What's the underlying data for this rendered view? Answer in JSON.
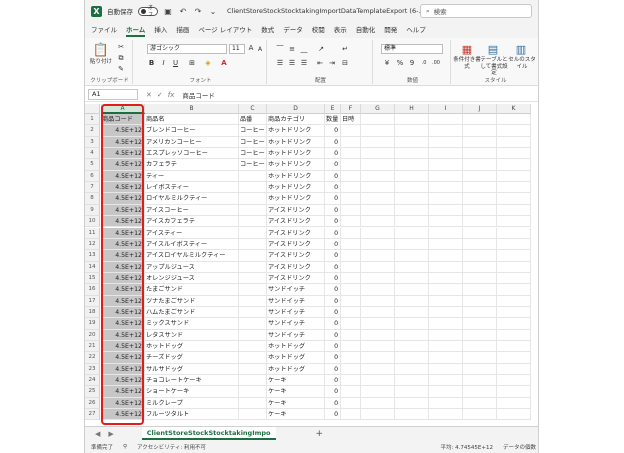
{
  "titlebar": {
    "autosave_label": "自動保存",
    "autosave_state": "オフ",
    "doc_title": "ClientStoreStockStocktakingImportDataTemplateExport (6-…",
    "search_placeholder": "検索"
  },
  "menu": {
    "tabs": [
      "ファイル",
      "ホーム",
      "挿入",
      "描画",
      "ページ レイアウト",
      "数式",
      "データ",
      "校閲",
      "表示",
      "自動化",
      "開発",
      "ヘルプ"
    ],
    "active": "ホーム"
  },
  "ribbon": {
    "paste_label": "貼り付け",
    "clipboard_label": "クリップボード",
    "font_name": "游ゴシック",
    "font_size": "11",
    "font_group_label": "フォント",
    "align_group_label": "配置",
    "number_format": "標準",
    "number_group_label": "数値",
    "cond_format_label": "条件付き書式",
    "table_format_label": "テーブルとして書式設定",
    "cell_style_label": "セルのスタイル",
    "style_group_label": "スタイル",
    "bold": "B",
    "italic": "I",
    "underline": "U",
    "percent": "%"
  },
  "formula": {
    "name_box": "A1",
    "fx": "fx",
    "value": "商品コード"
  },
  "grid": {
    "columns": [
      "A",
      "B",
      "C",
      "D",
      "E",
      "F",
      "G",
      "H",
      "I",
      "J",
      "K"
    ],
    "headers": [
      "商品コード",
      "商品名",
      "品番",
      "商品カテゴリ",
      "数量",
      "日時"
    ],
    "rows": [
      {
        "num": "2",
        "code": "4.5E+12",
        "name": "ブレンドコーヒー",
        "hinban": "コーヒー",
        "cat": "ホットドリンク",
        "qty": "0"
      },
      {
        "num": "3",
        "code": "4.5E+12",
        "name": "アメリカンコーヒー",
        "hinban": "コーヒー",
        "cat": "ホットドリンク",
        "qty": "0"
      },
      {
        "num": "4",
        "code": "4.5E+12",
        "name": "エスプレッソコーヒー",
        "hinban": "コーヒー",
        "cat": "ホットドリンク",
        "qty": "0"
      },
      {
        "num": "5",
        "code": "4.5E+12",
        "name": "カフェラテ",
        "hinban": "コーヒー",
        "cat": "ホットドリンク",
        "qty": "0"
      },
      {
        "num": "6",
        "code": "4.5E+12",
        "name": "ティー",
        "hinban": "",
        "cat": "ホットドリンク",
        "qty": "0"
      },
      {
        "num": "7",
        "code": "4.5E+12",
        "name": "レイボスティー",
        "hinban": "",
        "cat": "ホットドリンク",
        "qty": "0"
      },
      {
        "num": "8",
        "code": "4.5E+12",
        "name": "ロイヤルミルクティー",
        "hinban": "",
        "cat": "ホットドリンク",
        "qty": "0"
      },
      {
        "num": "9",
        "code": "4.5E+12",
        "name": "アイスコーヒー",
        "hinban": "",
        "cat": "アイスドリンク",
        "qty": "0"
      },
      {
        "num": "10",
        "code": "4.5E+12",
        "name": "アイスカフェラテ",
        "hinban": "",
        "cat": "アイスドリンク",
        "qty": "0"
      },
      {
        "num": "11",
        "code": "4.5E+12",
        "name": "アイスティー",
        "hinban": "",
        "cat": "アイスドリンク",
        "qty": "0"
      },
      {
        "num": "12",
        "code": "4.5E+12",
        "name": "アイスルイボスティー",
        "hinban": "",
        "cat": "アイスドリンク",
        "qty": "0"
      },
      {
        "num": "13",
        "code": "4.5E+12",
        "name": "アイスロイヤルミルクティー",
        "hinban": "",
        "cat": "アイスドリンク",
        "qty": "0"
      },
      {
        "num": "14",
        "code": "4.5E+12",
        "name": "アップルジュース",
        "hinban": "",
        "cat": "アイスドリンク",
        "qty": "0"
      },
      {
        "num": "15",
        "code": "4.5E+12",
        "name": "オレンジジュース",
        "hinban": "",
        "cat": "アイスドリンク",
        "qty": "0"
      },
      {
        "num": "16",
        "code": "4.5E+12",
        "name": "たまごサンド",
        "hinban": "",
        "cat": "サンドイッチ",
        "qty": "0"
      },
      {
        "num": "17",
        "code": "4.5E+12",
        "name": "ツナたまごサンド",
        "hinban": "",
        "cat": "サンドイッチ",
        "qty": "0"
      },
      {
        "num": "18",
        "code": "4.5E+12",
        "name": "ハムたまごサンド",
        "hinban": "",
        "cat": "サンドイッチ",
        "qty": "0"
      },
      {
        "num": "19",
        "code": "4.5E+12",
        "name": "ミックスサンド",
        "hinban": "",
        "cat": "サンドイッチ",
        "qty": "0"
      },
      {
        "num": "20",
        "code": "4.5E+12",
        "name": "レタスサンド",
        "hinban": "",
        "cat": "サンドイッチ",
        "qty": "0"
      },
      {
        "num": "21",
        "code": "4.5E+12",
        "name": "ホットドッグ",
        "hinban": "",
        "cat": "ホットドッグ",
        "qty": "0"
      },
      {
        "num": "22",
        "code": "4.5E+12",
        "name": "チーズドッグ",
        "hinban": "",
        "cat": "ホットドッグ",
        "qty": "0"
      },
      {
        "num": "23",
        "code": "4.5E+12",
        "name": "サルサドッグ",
        "hinban": "",
        "cat": "ホットドッグ",
        "qty": "0"
      },
      {
        "num": "24",
        "code": "4.5E+12",
        "name": "チョコレートケーキ",
        "hinban": "",
        "cat": "ケーキ",
        "qty": "0"
      },
      {
        "num": "25",
        "code": "4.5E+12",
        "name": "ショートケーキ",
        "hinban": "",
        "cat": "ケーキ",
        "qty": "0"
      },
      {
        "num": "26",
        "code": "4.5E+12",
        "name": "ミルクレープ",
        "hinban": "",
        "cat": "ケーキ",
        "qty": "0"
      },
      {
        "num": "27",
        "code": "4.5E+12",
        "name": "フルーツタルト",
        "hinban": "",
        "cat": "ケーキ",
        "qty": "0"
      }
    ]
  },
  "sheets": {
    "active_sheet": "ClientStoreStockStocktakingImpo",
    "add": "+"
  },
  "status": {
    "ready": "準備完了",
    "accessibility": "アクセシビリティ: 利用不可",
    "average": "平均: 4.74545E+12",
    "count": "データの個数"
  },
  "colors": {
    "excel_green": "#1d6f42",
    "highlight_red": "#e21b1b",
    "selected_column_fill": "#c6c6c6"
  }
}
